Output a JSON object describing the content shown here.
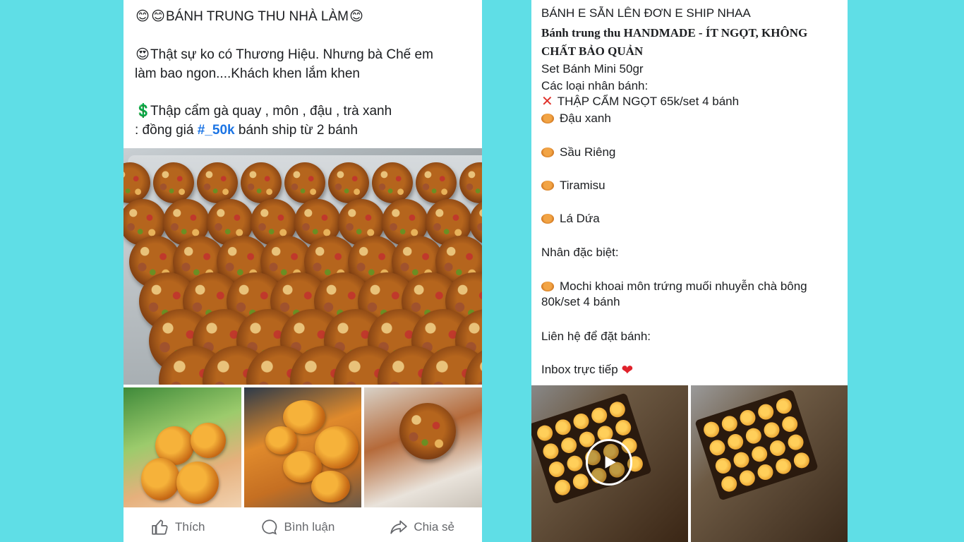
{
  "left_post": {
    "title_line": "BÁNH TRUNG THU NHÀ LÀM",
    "desc_line_1": "Thật sự ko có Thương Hiệu. Nhưng bà Chế em",
    "desc_line_2": "làm bao ngon....Khách khen lắm khen",
    "price_line_1": "Thập cẩm gà quay , môn , đậu , trà xanh",
    "price_line_2_prefix": ": đồng giá ",
    "price_hashtag": "#_50k",
    "price_line_2_suffix": " bánh  ship từ 2 bánh",
    "actions": {
      "like": "Thích",
      "comment": "Bình luận",
      "share": "Chia sẻ"
    }
  },
  "right_post": {
    "line_1": "BÁNH E SẴN LÊN ĐƠN E SHIP NHAA",
    "line_2": "Bánh trung thu HANDMADE - ÍT NGỌT, KHÔNG",
    "line_3": "CHẤT BẢO QUẢN",
    "line_4": "Set Bánh Mini 50gr",
    "line_5": "Các loại nhân bánh:",
    "line_6": "THẬP CẨM NGỌT 65k/set 4 bánh",
    "flavor_1": "Đậu xanh",
    "flavor_2": "Sầu Riêng",
    "flavor_3": "Tiramisu",
    "flavor_4": "Lá Dứa",
    "special_heading": "Nhân đặc biệt:",
    "special_1a": "Mochi khoai môn trứng muối nhuyễn chà bông",
    "special_1b": "80k/set 4 bánh",
    "contact_heading": "Liên hệ để đặt bánh:",
    "contact_line": "Inbox trực tiếp"
  },
  "colors": {
    "background": "#5fdee6",
    "hashtag": "#1b74e4",
    "action_text": "#65676b"
  }
}
